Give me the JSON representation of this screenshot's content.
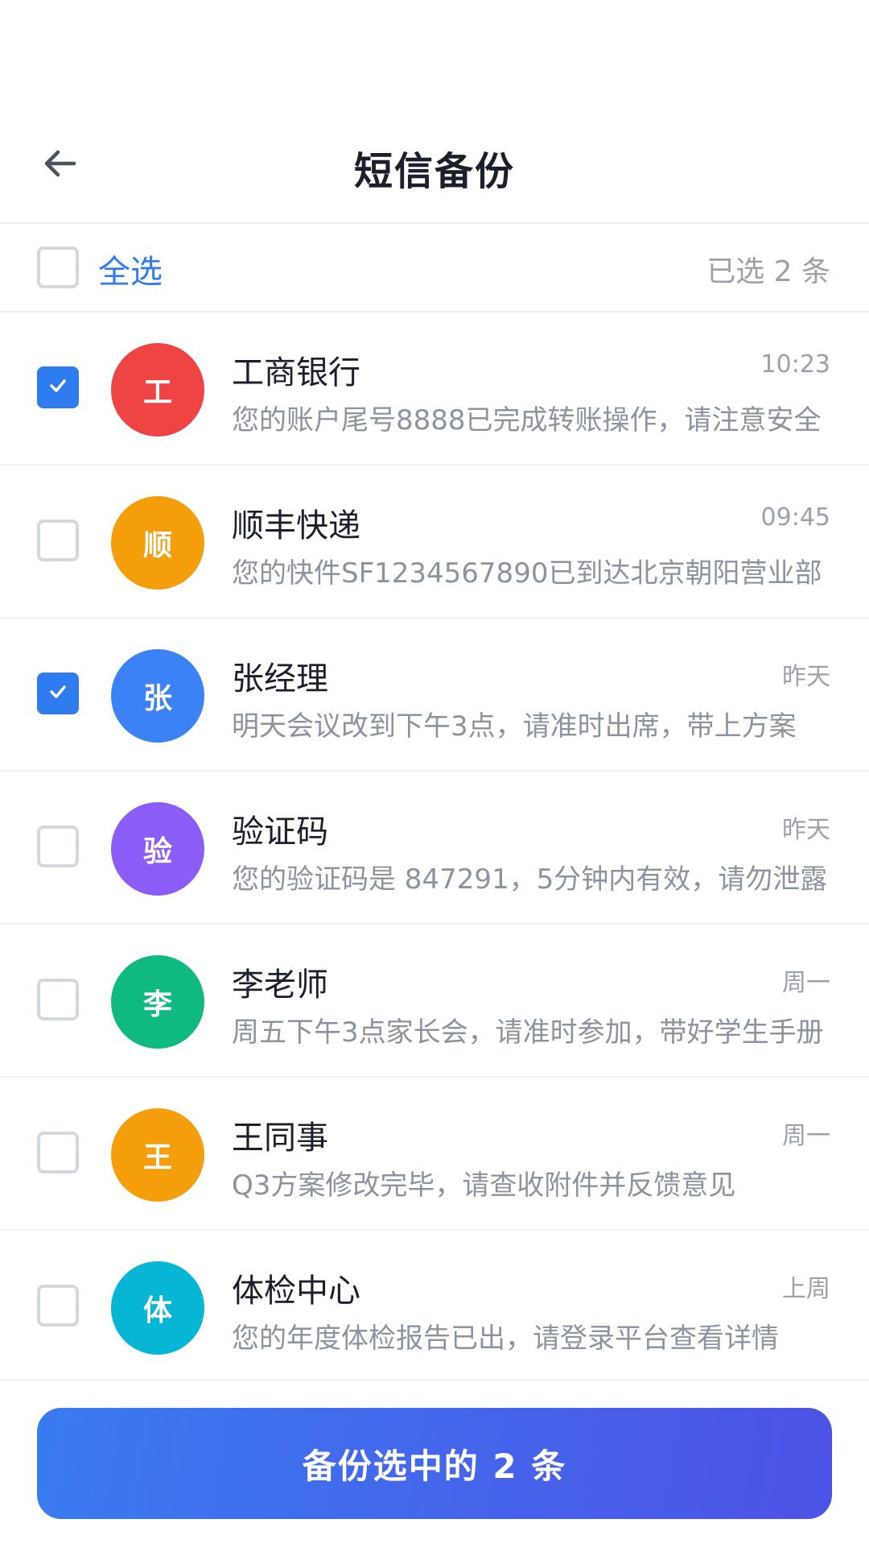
{
  "header": {
    "title": "短信备份",
    "back_icon": "arrow-left-icon"
  },
  "select_bar": {
    "select_all_label": "全选",
    "select_all_checked": false,
    "selected_count_text": "已选 2 条"
  },
  "messages": [
    {
      "sender": "工商银行",
      "avatar_text": "工",
      "avatar_color": "#ef4444",
      "time": "10:23",
      "preview": "您的账户尾号8888已完成转账操作，请注意安全",
      "checked": true
    },
    {
      "sender": "顺丰快递",
      "avatar_text": "顺",
      "avatar_color": "#f59e0b",
      "time": "09:45",
      "preview": "您的快件SF1234567890已到达北京朝阳营业部",
      "checked": false
    },
    {
      "sender": "张经理",
      "avatar_text": "张",
      "avatar_color": "#3b82f6",
      "time": "昨天",
      "preview": "明天会议改到下午3点，请准时出席，带上方案",
      "checked": true
    },
    {
      "sender": "验证码",
      "avatar_text": "验",
      "avatar_color": "#8b5cf6",
      "time": "昨天",
      "preview": "您的验证码是 847291，5分钟内有效，请勿泄露",
      "checked": false
    },
    {
      "sender": "李老师",
      "avatar_text": "李",
      "avatar_color": "#10b981",
      "time": "周一",
      "preview": "周五下午3点家长会，请准时参加，带好学生手册",
      "checked": false
    },
    {
      "sender": "王同事",
      "avatar_text": "王",
      "avatar_color": "#f59e0b",
      "time": "周一",
      "preview": "Q3方案修改完毕，请查收附件并反馈意见",
      "checked": false
    },
    {
      "sender": "体检中心",
      "avatar_text": "体",
      "avatar_color": "#06b6d4",
      "time": "上周",
      "preview": "您的年度体检报告已出，请登录平台查看详情",
      "checked": false
    }
  ],
  "footer": {
    "backup_button_label": "备份选中的 2 条"
  },
  "colors": {
    "accent": "#2f7bf0",
    "button_gradient_start": "#3a7bf0",
    "button_gradient_end": "#4d52e6"
  }
}
